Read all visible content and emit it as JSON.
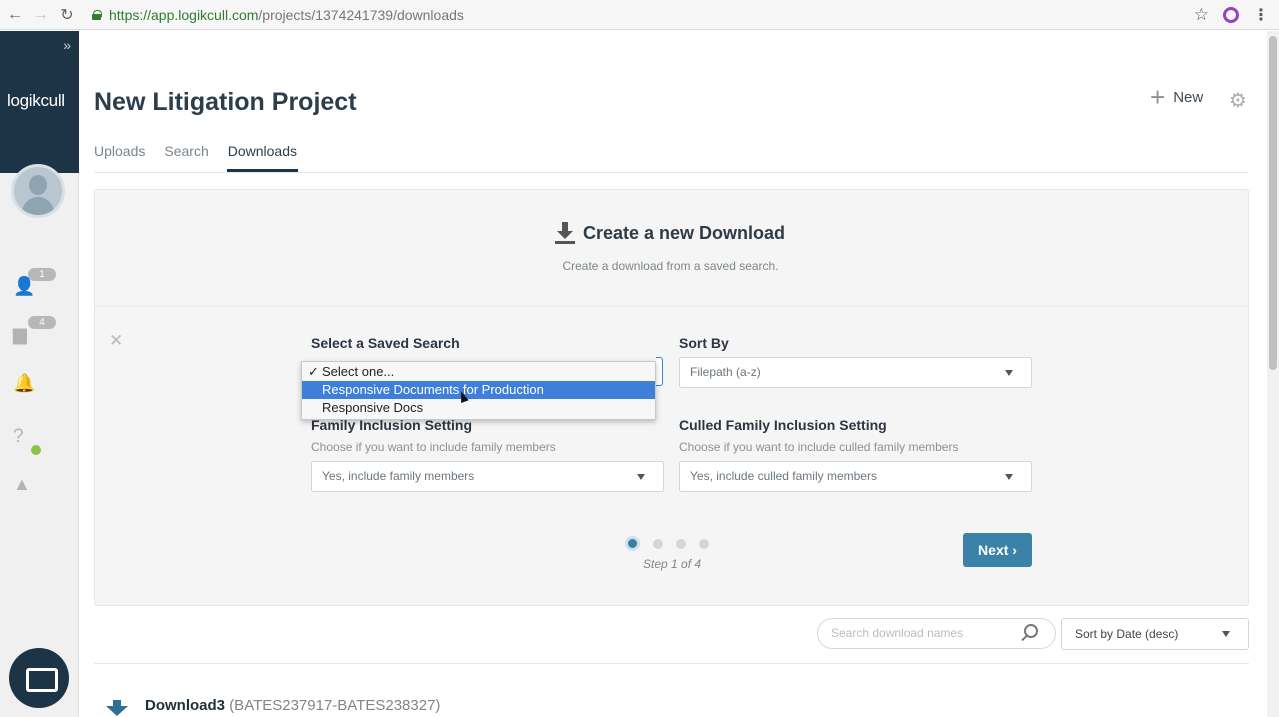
{
  "browser": {
    "url_host": "https://app.logikcull.com",
    "url_path": "/projects/1374241739/downloads"
  },
  "sidebar": {
    "brand": "logikcull",
    "badges": {
      "users": "1",
      "folders": "4"
    }
  },
  "header": {
    "title": "New Litigation Project",
    "new_label": "New",
    "tabs": [
      {
        "label": "Uploads"
      },
      {
        "label": "Search"
      },
      {
        "label": "Downloads",
        "active": true
      }
    ]
  },
  "wizard": {
    "title": "Create a new Download",
    "subtitle": "Create a download from a saved search.",
    "saved_search": {
      "label": "Select a Saved Search",
      "options": [
        "Select one...",
        "Responsive Documents for Production",
        "Responsive Docs"
      ],
      "checked_option": "Select one...",
      "highlighted_option": "Responsive Documents for Production"
    },
    "sort_by": {
      "label": "Sort By",
      "value": "Filepath (a-z)"
    },
    "family": {
      "label": "Family Inclusion Setting",
      "help": "Choose if you want to include family members",
      "value": "Yes, include family members"
    },
    "culled_family": {
      "label": "Culled Family Inclusion Setting",
      "help": "Choose if you want to include culled family members",
      "value": "Yes, include culled family members"
    },
    "step_text": "Step 1 of 4",
    "current_step": 1,
    "total_steps": 4,
    "next_label": "Next ›"
  },
  "downloads": {
    "search_placeholder": "Search download names",
    "sort_value": "Sort by Date (desc)",
    "items": [
      {
        "name": "Download3",
        "bates": "(BATES237917-BATES238327)"
      }
    ]
  },
  "colors": {
    "sidebar_brand": "#1d3446",
    "accent": "#3a82a8",
    "highlight": "#3d7fd9"
  }
}
